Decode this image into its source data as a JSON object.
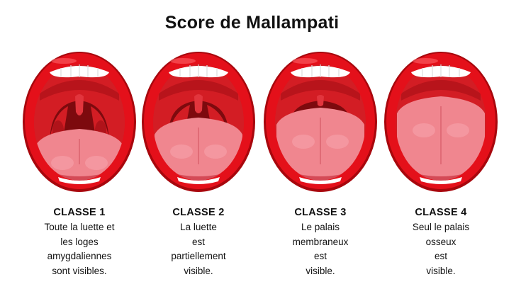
{
  "title": "Score de Mallampati",
  "colors": {
    "lip": "#e4101a",
    "lip_dark": "#a8070d",
    "throat": "#7d0a0e",
    "palate": "#d31d24",
    "tongue": "#f0868f",
    "teeth": "#ffffff"
  },
  "classes": [
    {
      "label": "CLASSE 1",
      "lines": [
        "Toute la luette et",
        "les loges",
        "amygdaliennes",
        "sont visibles."
      ],
      "visibility": 1
    },
    {
      "label": "CLASSE 2",
      "lines": [
        "La luette",
        "est",
        "partiellement",
        "visible."
      ],
      "visibility": 2
    },
    {
      "label": "CLASSE 3",
      "lines": [
        "Le palais",
        "membraneux",
        "est",
        "visible."
      ],
      "visibility": 3
    },
    {
      "label": "CLASSE 4",
      "lines": [
        "Seul le palais",
        "osseux",
        "est",
        "visible."
      ],
      "visibility": 4
    }
  ]
}
